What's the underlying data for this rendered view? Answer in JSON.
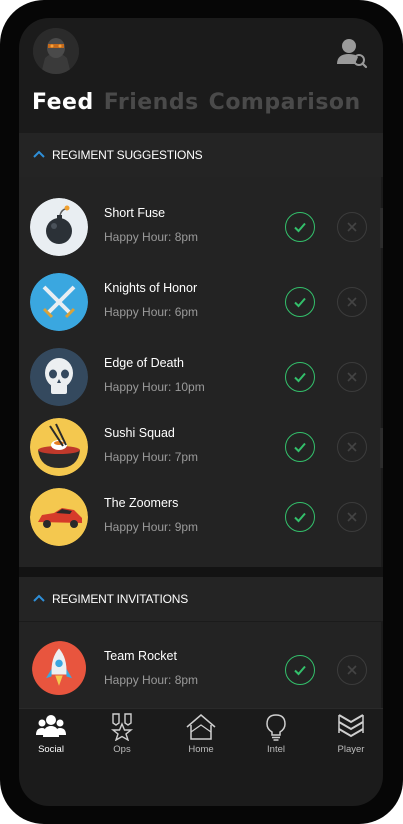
{
  "tabs": [
    {
      "label": "Feed",
      "active": true
    },
    {
      "label": "Friends",
      "active": false
    },
    {
      "label": "Comparison",
      "active": false
    }
  ],
  "sections": {
    "suggestions": {
      "title": "REGIMENT SUGGESTIONS"
    },
    "invitations": {
      "title": "REGIMENT INVITATIONS"
    }
  },
  "suggestions": [
    {
      "name": "Short Fuse",
      "happy_hour": "Happy Hour: 8pm",
      "icon": "bomb-icon"
    },
    {
      "name": "Knights of Honor",
      "happy_hour": "Happy Hour: 6pm",
      "icon": "crossed-swords-icon"
    },
    {
      "name": "Edge of Death",
      "happy_hour": "Happy Hour: 10pm",
      "icon": "skull-icon"
    },
    {
      "name": "Sushi Squad",
      "happy_hour": "Happy Hour: 7pm",
      "icon": "sushi-bowl-icon"
    },
    {
      "name": "The Zoomers",
      "happy_hour": "Happy Hour: 9pm",
      "icon": "race-car-icon"
    }
  ],
  "invitations": [
    {
      "name": "Team Rocket",
      "happy_hour": "Happy Hour: 8pm",
      "icon": "rocket-icon"
    }
  ],
  "nav": [
    {
      "label": "Social",
      "icon": "people-icon",
      "active": true
    },
    {
      "label": "Ops",
      "icon": "medal-icon",
      "active": false
    },
    {
      "label": "Home",
      "icon": "home-icon",
      "active": false
    },
    {
      "label": "Intel",
      "icon": "lightbulb-icon",
      "active": false
    },
    {
      "label": "Player",
      "icon": "chevron-rank-icon",
      "active": false
    }
  ],
  "colors": {
    "accent_green": "#33c06b",
    "accent_blue": "#2e8fd8",
    "background": "#1b1b1b"
  }
}
